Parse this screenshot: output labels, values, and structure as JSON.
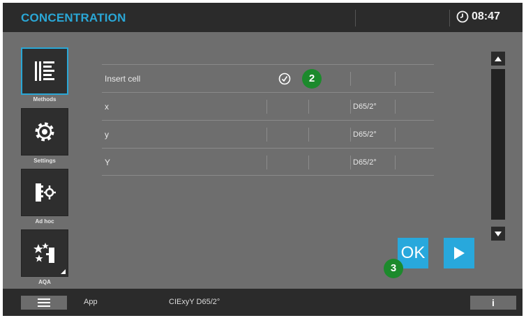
{
  "header": {
    "title": "CONCENTRATION",
    "time": "08:47",
    "clock_icon": "clock-icon"
  },
  "sidebar": {
    "items": [
      {
        "label": "Methods",
        "icon": "methods-list-icon",
        "active": true
      },
      {
        "label": "Settings",
        "icon": "gear-icon",
        "active": false
      },
      {
        "label": "Ad hoc",
        "icon": "ad-hoc-icon",
        "active": false
      },
      {
        "label": "AQA",
        "icon": "aqa-stars-icon",
        "active": false
      }
    ]
  },
  "table": {
    "rows": [
      {
        "label": "Insert cell",
        "unit": "",
        "status_icon": "check-circle-icon"
      },
      {
        "label": "x",
        "unit": "D65/2°"
      },
      {
        "label": "y",
        "unit": "D65/2°"
      },
      {
        "label": "Y",
        "unit": "D65/2°"
      }
    ]
  },
  "callouts": {
    "one": "2",
    "two": "3"
  },
  "actions": {
    "ok_label": "OK",
    "next_icon": "play-arrow-icon"
  },
  "footer": {
    "menu_icon": "hamburger-menu-icon",
    "app_label": "App",
    "method_label": "CIExyY D65/2°",
    "info_label": "i"
  },
  "colors": {
    "accent": "#28a8dc",
    "callout": "#1c8a2c",
    "background": "#6e6e6e",
    "bars": "#2b2b2b"
  }
}
